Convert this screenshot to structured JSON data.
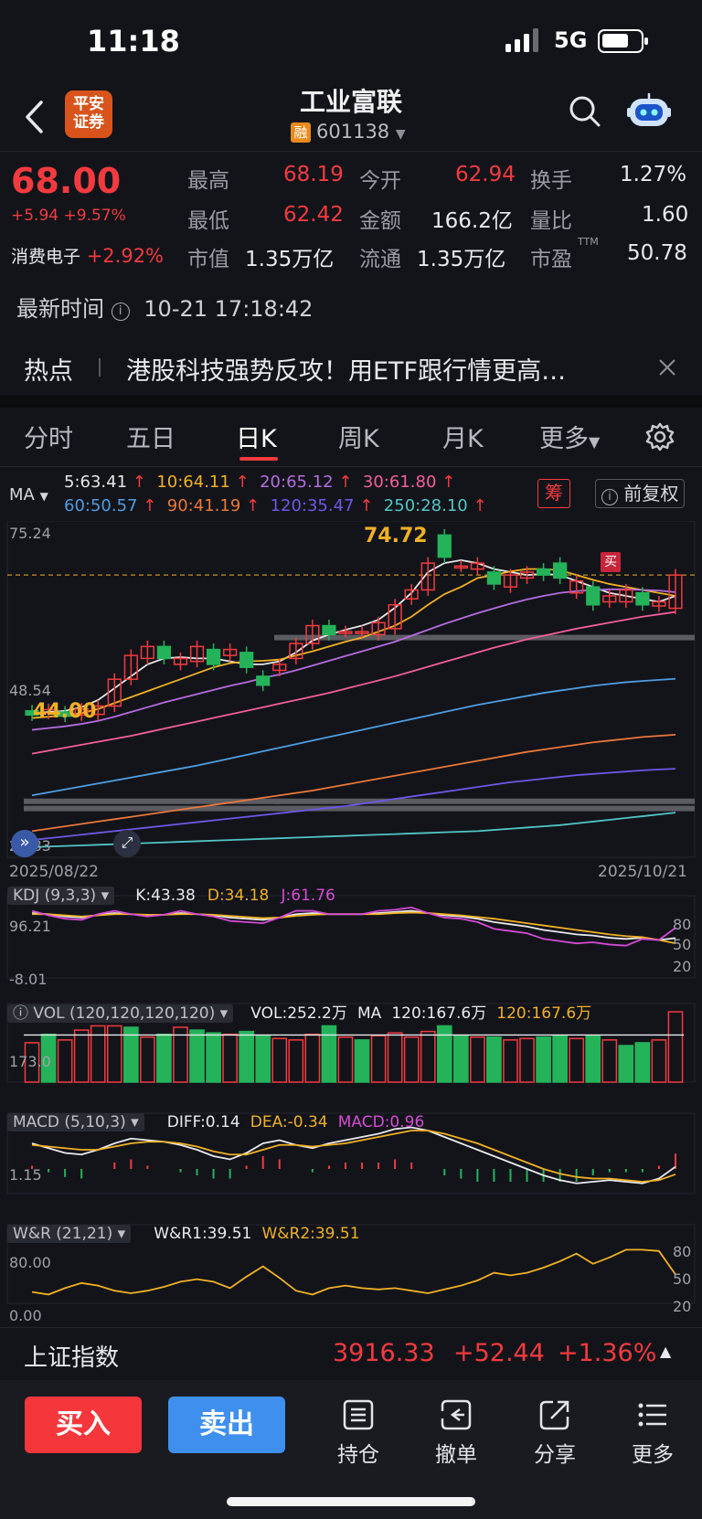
{
  "status": {
    "time": "11:18",
    "network": "5G"
  },
  "header": {
    "logo_text_1": "平安",
    "logo_text_2": "证券",
    "title": "工业富联",
    "margin_tag": "融",
    "code": "601138"
  },
  "quote": {
    "price": "68.00",
    "change": "+5.94",
    "change_pct": "+9.57%",
    "sector_name": "消费电子",
    "sector_pct": "+2.92%",
    "high_label": "最高",
    "high": "68.19",
    "open_label": "今开",
    "open": "62.94",
    "turnover_label": "换手",
    "turnover": "1.27%",
    "low_label": "最低",
    "low": "62.42",
    "amount_label": "金额",
    "amount": "166.2亿",
    "vol_ratio_label": "量比",
    "vol_ratio": "1.60",
    "mcap_label": "市值",
    "mcap": "1.35万亿",
    "float_label": "流通",
    "float": "1.35万亿",
    "pe_label": "市盈",
    "pe_sup": "TTM",
    "pe": "50.78"
  },
  "update": {
    "label": "最新时间",
    "value": "10-21 17:18:42"
  },
  "hot": {
    "tag": "热点",
    "text": "港股科技强势反攻！用ETF跟行情更高…"
  },
  "tabs": [
    "分时",
    "五日",
    "日K",
    "周K",
    "月K",
    "更多"
  ],
  "ma_bar": {
    "ma_label": "MA",
    "ma5": "5:63.41",
    "ma10": "10:64.11",
    "ma20": "20:65.12",
    "ma30": "30:61.80",
    "ma60": "60:50.57",
    "ma90": "90:41.19",
    "ma120": "120:35.47",
    "ma250": "250:28.10",
    "chip_tag": "筹",
    "adjust": "前复权",
    "arrow": "↑"
  },
  "kline": {
    "y_top": "75.24",
    "y_mid": "48.54",
    "y_bot": "21.83",
    "high_mark": "74.72",
    "low_mark": "44.00",
    "buy_tag": "买",
    "date_start": "2025/08/22",
    "date_end": "2025/10/21"
  },
  "kdj": {
    "label": "KDJ (9,3,3)",
    "k": "K:43.38",
    "d": "D:34.18",
    "j": "J:61.76",
    "y_top": "96.21",
    "y_bot": "-8.01",
    "r1": "80",
    "r2": "50",
    "r3": "20"
  },
  "vol": {
    "label": "VOL (120,120,120,120)",
    "vol": "VOL:252.2万",
    "ma": "MA",
    "ma120a": "120:167.6万",
    "ma120b": "120:167.6万",
    "y": "173.0"
  },
  "macd": {
    "label": "MACD (5,10,3)",
    "diff": "DIFF:0.14",
    "dea": "DEA:-0.34",
    "macd": "MACD:0.96",
    "y": "1.15"
  },
  "wr": {
    "label": "W&R (21,21)",
    "wr1": "W&R1:39.51",
    "wr2": "W&R2:39.51",
    "y_top": "80.00",
    "y_bot": "0.00",
    "r1": "80",
    "r2": "50",
    "r3": "20"
  },
  "index": {
    "name": "上证指数",
    "value": "3916.33",
    "change": "+52.44",
    "pct": "+1.36%"
  },
  "actions": {
    "buy": "买入",
    "sell": "卖出",
    "positions": "持仓",
    "cancel": "撤单",
    "share": "分享",
    "more": "更多"
  },
  "colors": {
    "up": "#f23b3f",
    "down": "#25b35a",
    "buy_btn": "#f5373b",
    "sell_btn": "#3f8fee",
    "bg": "#13141a"
  },
  "chart_data": {
    "type": "candlestick",
    "ylim": [
      21.83,
      75.24
    ],
    "candles": [
      {
        "o": 45.2,
        "c": 44.5
      },
      {
        "o": 44.8,
        "c": 45.4
      },
      {
        "o": 45.0,
        "c": 44.3
      },
      {
        "o": 44.5,
        "c": 45.5
      },
      {
        "o": 44.6,
        "c": 46.0
      },
      {
        "o": 46.0,
        "c": 50.5
      },
      {
        "o": 50.5,
        "c": 54.5
      },
      {
        "o": 54.0,
        "c": 56.0
      },
      {
        "o": 56.0,
        "c": 54.0
      },
      {
        "o": 53.0,
        "c": 54.0
      },
      {
        "o": 53.5,
        "c": 56.0
      },
      {
        "o": 55.5,
        "c": 53.0
      },
      {
        "o": 54.5,
        "c": 55.5
      },
      {
        "o": 55.0,
        "c": 52.5
      },
      {
        "o": 51.0,
        "c": 49.5
      },
      {
        "o": 52.0,
        "c": 53.0
      },
      {
        "o": 54.0,
        "c": 56.5
      },
      {
        "o": 56.5,
        "c": 59.5
      },
      {
        "o": 59.5,
        "c": 58.0
      },
      {
        "o": 58.5,
        "c": 58.5
      },
      {
        "o": 58.5,
        "c": 58.5
      },
      {
        "o": 58.0,
        "c": 60.0
      },
      {
        "o": 59.0,
        "c": 63.0
      },
      {
        "o": 64.0,
        "c": 65.5
      },
      {
        "o": 65.5,
        "c": 70.0
      },
      {
        "o": 74.72,
        "c": 71.0
      },
      {
        "o": 69.5,
        "c": 69.5
      },
      {
        "o": 69.0,
        "c": 70.0
      },
      {
        "o": 68.5,
        "c": 66.5
      },
      {
        "o": 66.0,
        "c": 68.0
      },
      {
        "o": 67.5,
        "c": 68.5
      },
      {
        "o": 69.0,
        "c": 68.0
      },
      {
        "o": 70.0,
        "c": 67.5
      },
      {
        "o": 65.0,
        "c": 67.0
      },
      {
        "o": 66.0,
        "c": 63.0
      },
      {
        "o": 63.5,
        "c": 64.5
      },
      {
        "o": 63.5,
        "c": 65.5
      },
      {
        "o": 65.0,
        "c": 63.0
      },
      {
        "o": 62.8,
        "c": 63.5
      },
      {
        "o": 62.42,
        "c": 68.0
      }
    ],
    "ma_series": [
      {
        "name": "5",
        "color": "#e6e6e6",
        "values": [
          44.8,
          45.0,
          45.2,
          45.8,
          47.0,
          49.0,
          51.0,
          53.0,
          54.0,
          54.2,
          54.0,
          54.0,
          53.5,
          53.0,
          53.0,
          53.5,
          55.0,
          57.0,
          58.0,
          58.8,
          59.5,
          60.5,
          62.5,
          65.0,
          68.5,
          70.0,
          70.5,
          70.0,
          69.0,
          68.5,
          68.0,
          68.2,
          68.0,
          67.0,
          66.0,
          65.0,
          64.5,
          64.0,
          63.5,
          64.5
        ]
      },
      {
        "name": "10",
        "color": "#f0b125",
        "values": [
          44.0,
          44.2,
          44.5,
          44.8,
          45.5,
          46.5,
          47.5,
          48.5,
          49.5,
          50.5,
          51.5,
          52.5,
          53.2,
          53.5,
          53.6,
          53.8,
          54.5,
          55.2,
          56.0,
          56.8,
          57.5,
          58.5,
          59.5,
          61.0,
          63.0,
          64.8,
          66.0,
          67.5,
          68.0,
          68.6,
          69.0,
          69.0,
          68.8,
          68.0,
          67.2,
          66.5,
          66.0,
          65.5,
          65.0,
          64.5
        ]
      },
      {
        "name": "20",
        "color": "#b46dde",
        "values": [
          42.0,
          42.3,
          42.6,
          43.0,
          43.5,
          44.2,
          45.0,
          45.8,
          46.6,
          47.3,
          48.0,
          48.7,
          49.4,
          50.0,
          50.7,
          51.3,
          52.0,
          52.8,
          53.6,
          54.4,
          55.2,
          56.0,
          56.8,
          57.8,
          58.8,
          59.8,
          60.7,
          61.6,
          62.4,
          63.2,
          63.9,
          64.5,
          65.0,
          65.3,
          65.5,
          65.6,
          65.6,
          65.5,
          65.4,
          65.12
        ]
      },
      {
        "name": "30",
        "color": "#f25f9a",
        "values": [
          38.0,
          38.5,
          39.0,
          39.5,
          40.0,
          40.5,
          41.0,
          41.6,
          42.2,
          42.8,
          43.4,
          44.0,
          44.6,
          45.2,
          45.8,
          46.4,
          47.0,
          47.6,
          48.2,
          48.9,
          49.6,
          50.3,
          51.0,
          51.8,
          52.6,
          53.4,
          54.2,
          55.0,
          55.8,
          56.5,
          57.2,
          57.8,
          58.4,
          59.0,
          59.5,
          60.0,
          60.5,
          61.0,
          61.4,
          61.8
        ]
      },
      {
        "name": "60",
        "color": "#4f9ee0",
        "values": [
          31.0,
          31.5,
          32.0,
          32.5,
          33.0,
          33.5,
          34.0,
          34.5,
          35.0,
          35.5,
          36.0,
          36.6,
          37.2,
          37.8,
          38.4,
          39.0,
          39.6,
          40.2,
          40.8,
          41.4,
          42.0,
          42.6,
          43.2,
          43.8,
          44.4,
          45.0,
          45.6,
          46.2,
          46.7,
          47.2,
          47.7,
          48.2,
          48.6,
          49.0,
          49.4,
          49.7,
          50.0,
          50.2,
          50.4,
          50.57
        ]
      },
      {
        "name": "90",
        "color": "#e9783a",
        "values": [
          25.0,
          25.4,
          25.8,
          26.2,
          26.6,
          27.0,
          27.4,
          27.8,
          28.2,
          28.6,
          29.0,
          29.4,
          29.8,
          30.2,
          30.6,
          31.0,
          31.4,
          31.8,
          32.3,
          32.8,
          33.3,
          33.8,
          34.3,
          34.8,
          35.3,
          35.8,
          36.3,
          36.8,
          37.3,
          37.8,
          38.3,
          38.7,
          39.1,
          39.5,
          39.9,
          40.2,
          40.5,
          40.8,
          41.0,
          41.19
        ]
      },
      {
        "name": "120",
        "color": "#6e58e6",
        "values": [
          23.5,
          23.8,
          24.1,
          24.4,
          24.7,
          25.0,
          25.3,
          25.6,
          25.9,
          26.2,
          26.5,
          26.8,
          27.1,
          27.4,
          27.7,
          28.0,
          28.3,
          28.6,
          28.9,
          29.2,
          29.6,
          30.0,
          30.4,
          30.8,
          31.2,
          31.6,
          32.0,
          32.4,
          32.8,
          33.2,
          33.5,
          33.8,
          34.1,
          34.4,
          34.6,
          34.8,
          35.0,
          35.2,
          35.35,
          35.47
        ]
      },
      {
        "name": "250",
        "color": "#52c6c6",
        "values": [
          22.3,
          22.4,
          22.5,
          22.6,
          22.7,
          22.8,
          22.9,
          23.0,
          23.1,
          23.2,
          23.3,
          23.4,
          23.5,
          23.6,
          23.7,
          23.8,
          23.9,
          24.0,
          24.1,
          24.2,
          24.3,
          24.4,
          24.5,
          24.6,
          24.7,
          24.8,
          24.9,
          25.0,
          25.2,
          25.4,
          25.6,
          25.8,
          26.0,
          26.3,
          26.6,
          26.9,
          27.2,
          27.5,
          27.8,
          28.1
        ]
      }
    ],
    "kdj": {
      "k": [
        88,
        86,
        82,
        80,
        85,
        88,
        86,
        84,
        85,
        88,
        86,
        84,
        80,
        78,
        76,
        80,
        86,
        88,
        86,
        86,
        86,
        88,
        90,
        92,
        88,
        84,
        82,
        78,
        72,
        68,
        64,
        58,
        54,
        50,
        48,
        44,
        42,
        44,
        40,
        43.38
      ],
      "d": [
        86,
        86,
        84,
        82,
        84,
        86,
        86,
        85,
        85,
        86,
        86,
        85,
        83,
        81,
        79,
        80,
        83,
        85,
        86,
        86,
        86,
        86,
        88,
        89,
        88,
        86,
        84,
        81,
        78,
        74,
        70,
        66,
        62,
        58,
        54,
        50,
        47,
        45,
        40,
        34.18
      ],
      "j": [
        92,
        84,
        78,
        76,
        86,
        92,
        86,
        82,
        85,
        92,
        86,
        82,
        74,
        72,
        70,
        80,
        92,
        92,
        86,
        86,
        86,
        92,
        94,
        98,
        88,
        80,
        78,
        72,
        60,
        56,
        52,
        42,
        38,
        34,
        36,
        32,
        30,
        42,
        40,
        61.76
      ]
    },
    "volume": {
      "values": [
        140,
        170,
        150,
        185,
        200,
        200,
        195,
        160,
        170,
        195,
        185,
        175,
        170,
        180,
        165,
        155,
        150,
        170,
        200,
        160,
        150,
        165,
        175,
        160,
        180,
        200,
        165,
        160,
        160,
        150,
        155,
        160,
        165,
        155,
        165,
        150,
        130,
        140,
        150,
        250
      ],
      "up": [
        true,
        false,
        true,
        true,
        true,
        true,
        false,
        true,
        false,
        true,
        false,
        false,
        true,
        false,
        false,
        true,
        true,
        true,
        false,
        true,
        false,
        true,
        true,
        true,
        true,
        false,
        false,
        true,
        false,
        true,
        true,
        false,
        false,
        true,
        false,
        true,
        false,
        false,
        true,
        true
      ],
      "ma": 167.6
    },
    "macd": {
      "diff": [
        1.6,
        1.3,
        1.0,
        0.9,
        1.2,
        1.6,
        1.9,
        1.8,
        1.7,
        1.5,
        1.2,
        0.8,
        0.6,
        1.0,
        1.6,
        1.8,
        1.5,
        1.3,
        1.6,
        1.8,
        2.0,
        2.2,
        2.5,
        2.6,
        2.4,
        2.0,
        1.6,
        1.2,
        0.8,
        0.4,
        0.0,
        -0.4,
        -0.7,
        -0.9,
        -0.8,
        -0.7,
        -0.8,
        -0.9,
        -0.6,
        0.14
      ],
      "dea": [
        1.5,
        1.4,
        1.3,
        1.2,
        1.2,
        1.4,
        1.6,
        1.7,
        1.7,
        1.6,
        1.4,
        1.1,
        0.9,
        0.9,
        1.2,
        1.5,
        1.5,
        1.4,
        1.5,
        1.6,
        1.8,
        2.0,
        2.2,
        2.4,
        2.4,
        2.2,
        1.9,
        1.6,
        1.2,
        0.8,
        0.4,
        0.0,
        -0.3,
        -0.5,
        -0.6,
        -0.6,
        -0.7,
        -0.8,
        -0.7,
        -0.34
      ],
      "hist": [
        0.2,
        -0.2,
        -0.5,
        -0.6,
        0.0,
        0.4,
        0.6,
        0.2,
        0.0,
        -0.2,
        -0.4,
        -0.6,
        -0.6,
        0.2,
        0.8,
        0.6,
        0.0,
        -0.2,
        0.2,
        0.4,
        0.4,
        0.4,
        0.6,
        0.4,
        0.0,
        -0.4,
        -0.6,
        -0.8,
        -0.8,
        -0.8,
        -0.8,
        -0.8,
        -0.8,
        -0.8,
        -0.4,
        -0.2,
        -0.2,
        -0.2,
        0.2,
        0.96
      ],
      "ylim": [
        -1.2,
        2.8
      ]
    },
    "wr": {
      "values": [
        12,
        8,
        18,
        26,
        22,
        14,
        10,
        14,
        20,
        28,
        32,
        28,
        18,
        36,
        52,
        34,
        14,
        8,
        18,
        22,
        18,
        16,
        18,
        14,
        10,
        16,
        22,
        30,
        42,
        38,
        42,
        50,
        60,
        72,
        56,
        66,
        78,
        78,
        76,
        39.51
      ],
      "ylim": [
        0,
        100
      ]
    }
  }
}
